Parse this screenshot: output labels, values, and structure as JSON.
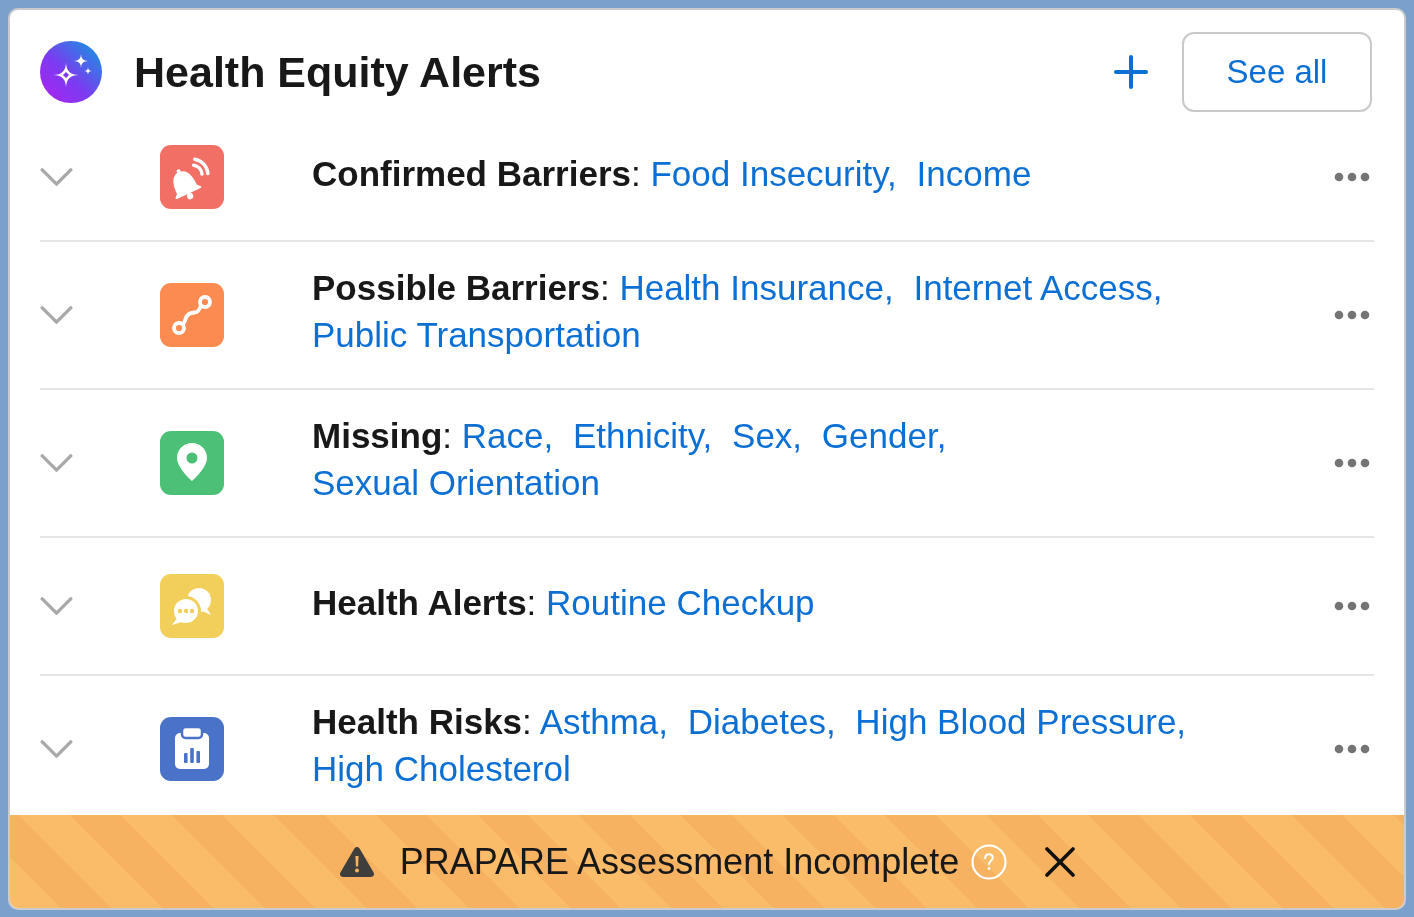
{
  "header": {
    "title": "Health Equity Alerts",
    "see_all_label": "See all"
  },
  "alerts": [
    {
      "kind": "bell",
      "color": "#f26f66",
      "label": "**Confirmed Barriers**:",
      "items": [
        "Food Insecurity,",
        "Income"
      ]
    },
    {
      "kind": "route",
      "color": "#fc8b52",
      "label": "**Possible Barriers**:",
      "items": [
        "Health Insurance,",
        "Internet Access,",
        "Public Transportation"
      ]
    },
    {
      "kind": "pin",
      "color": "#4bc076",
      "label": "**Missing**:",
      "items": [
        "Race,",
        "Ethnicity,",
        "Sex,",
        "Gender,",
        "Sexual Orientation"
      ]
    },
    {
      "kind": "chat",
      "color": "#f2cf5b",
      "label": "**Health Alerts**:",
      "items": [
        "Routine Checkup"
      ]
    },
    {
      "kind": "clipboard",
      "color": "#4a72c8",
      "label": "**Health Risks**:",
      "items": [
        "Asthma,",
        "Diabetes,",
        "High Blood Pressure,",
        "High Cholesterol"
      ]
    }
  ],
  "banner": {
    "message": "PRAPARE Assessment Incomplete"
  }
}
